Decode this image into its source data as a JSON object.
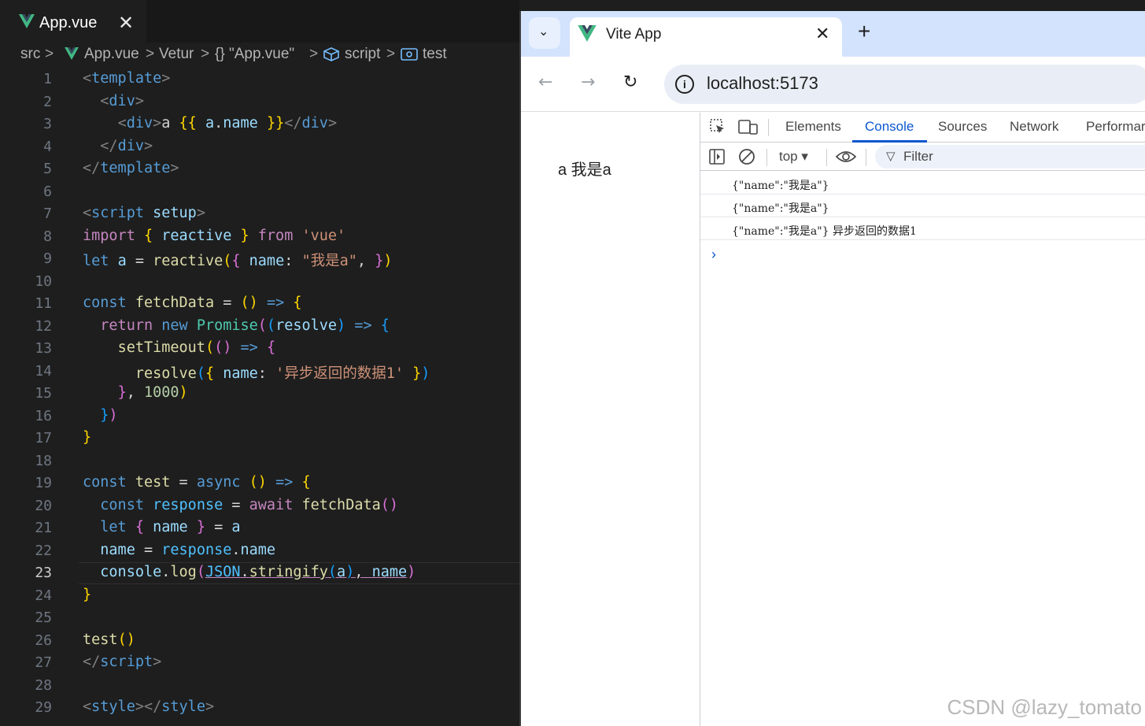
{
  "editor": {
    "tab": {
      "label": "App.vue",
      "close": "✕"
    },
    "breadcrumb": [
      "src",
      "App.vue",
      "Vetur",
      "{} \"App.vue\"",
      "script",
      "test"
    ],
    "breadcrumb_sep": ">",
    "current_line": 23
  },
  "browser": {
    "tab_title": "Vite App",
    "tab_close": "✕",
    "new_tab": "+",
    "url": "localhost:5173",
    "page_text": "a 我是a",
    "devtools": {
      "tabs": [
        "Elements",
        "Console",
        "Sources",
        "Network",
        "Performar"
      ],
      "active_tab": "Console",
      "context": "top ▾",
      "filter_placeholder": "Filter",
      "messages": [
        "{\"name\":\"我是a\"}",
        "{\"name\":\"我是a\"}",
        "{\"name\":\"我是a\"} 异步返回的数据1"
      ],
      "prompt": "›"
    }
  },
  "watermark": "CSDN @lazy_tomato",
  "colors": {
    "vue_green": "#41b883",
    "vue_dark": "#35495e",
    "accent": "#0b57d0"
  }
}
